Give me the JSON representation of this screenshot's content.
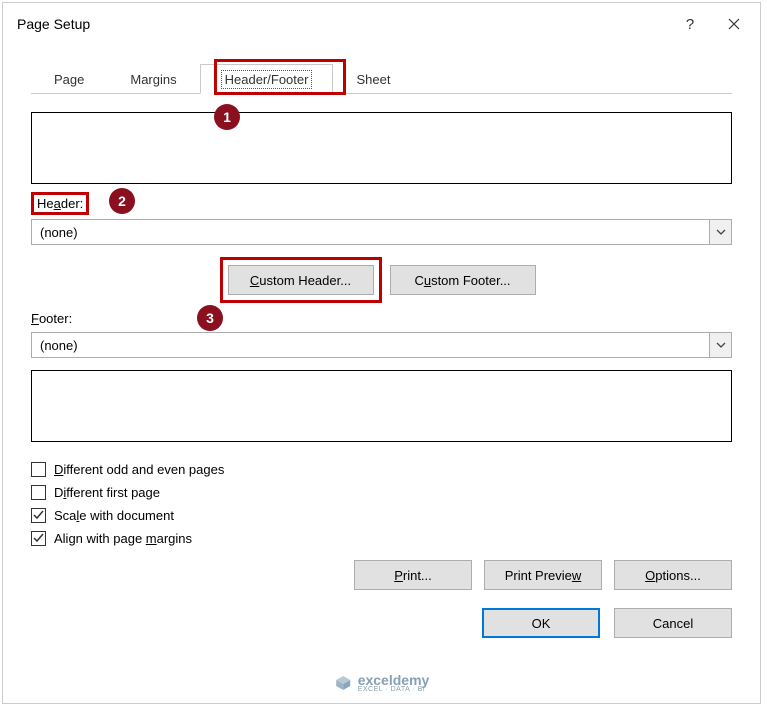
{
  "title": "Page Setup",
  "tabs": {
    "page": "Page",
    "margins": "Margins",
    "header_footer": "Header/Footer",
    "sheet": "Sheet"
  },
  "labels": {
    "header_prefix": "He",
    "header_u": "a",
    "header_suffix": "der:",
    "footer_u": "F",
    "footer_suffix": "ooter:"
  },
  "combos": {
    "header_value": "(none)",
    "footer_value": "(none)"
  },
  "buttons": {
    "custom_header_u": "C",
    "custom_header_rest": "ustom Header...",
    "custom_footer": "C",
    "custom_footer_u": "u",
    "custom_footer_rest": "stom Footer...",
    "print_u": "P",
    "print_rest": "rint...",
    "preview": "Print Previe",
    "preview_u": "w",
    "options_u": "O",
    "options_rest": "ptions...",
    "ok": "OK",
    "cancel": "Cancel"
  },
  "checks": {
    "diff_odd_u": "D",
    "diff_odd_rest": "ifferent odd and even pages",
    "diff_first": "D",
    "diff_first_u": "i",
    "diff_first_rest": "fferent first page",
    "scale": "Sca",
    "scale_u": "l",
    "scale_rest": "e with document",
    "align": "Align with page ",
    "align_u": "m",
    "align_rest": "argins"
  },
  "badges": {
    "b1": "1",
    "b2": "2",
    "b3": "3"
  },
  "logo": {
    "main": "exceldemy",
    "sub": "EXCEL · DATA · BI"
  }
}
